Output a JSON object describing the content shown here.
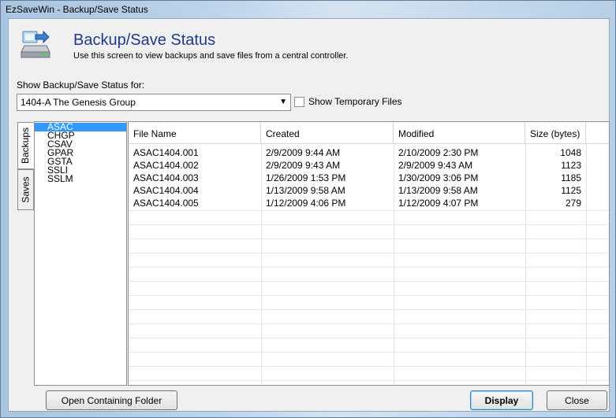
{
  "window": {
    "title": "EzSaveWin - Backup/Save Status"
  },
  "header": {
    "title": "Backup/Save Status",
    "subtitle": "Use this screen to view backups and save files from a central controller.",
    "icon": "backup-disk-icon"
  },
  "filter": {
    "label": "Show Backup/Save Status for:",
    "selected": "1404-A The Genesis Group",
    "show_temp_label": "Show Temporary Files",
    "show_temp_checked": false
  },
  "tabs": [
    {
      "label": "Backups",
      "active": true
    },
    {
      "label": "Saves",
      "active": false
    }
  ],
  "list": {
    "items": [
      "ASAC",
      "CHGP",
      "CSAV",
      "GPAR",
      "GSTA",
      "SSLI",
      "SSLM"
    ],
    "selected_index": 0
  },
  "table": {
    "columns": [
      "File Name",
      "Created",
      "Modified",
      "Size (bytes)"
    ],
    "rows": [
      [
        "ASAC1404.001",
        "2/9/2009 9:44 AM",
        "2/10/2009 2:30 PM",
        "1048"
      ],
      [
        "ASAC1404.002",
        "2/9/2009 9:43 AM",
        "2/9/2009 9:43 AM",
        "1123"
      ],
      [
        "ASAC1404.003",
        "1/26/2009 1:53 PM",
        "1/30/2009 3:06 PM",
        "1185"
      ],
      [
        "ASAC1404.004",
        "1/13/2009 9:58 AM",
        "1/13/2009 9:58 AM",
        "1125"
      ],
      [
        "ASAC1404.005",
        "1/12/2009 4:06 PM",
        "1/12/2009 4:07 PM",
        "279"
      ]
    ]
  },
  "buttons": {
    "open_folder": "Open Containing Folder",
    "display": "Display",
    "close": "Close"
  },
  "colors": {
    "title": "#1e3a8c",
    "selection": "#3399ff"
  }
}
